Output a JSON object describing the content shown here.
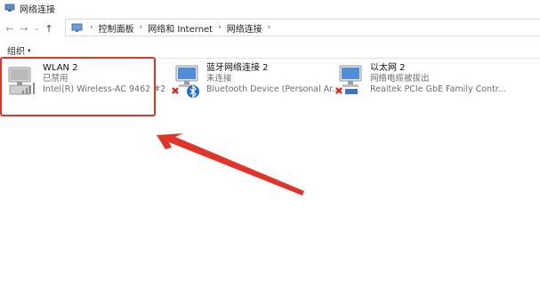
{
  "window": {
    "title": "网络连接"
  },
  "nav": {
    "back_glyph": "←",
    "forward_glyph": "→",
    "recent_glyph": "⌄",
    "up_glyph": "↑"
  },
  "address": {
    "separator": "›",
    "crumbs": [
      "控制面板",
      "网络和 Internet",
      "网络连接"
    ]
  },
  "commandbar": {
    "organize_label": "组织",
    "organize_caret": "▾"
  },
  "connections": [
    {
      "name": "WLAN 2",
      "status": "已禁用",
      "device": "Intel(R) Wireless-AC 9462 #2",
      "icon": "wifi-adapter-icon",
      "disabled": true
    },
    {
      "name": "蓝牙网络连接 2",
      "status": "未连接",
      "device": "Bluetooth Device (Personal Ar...",
      "icon": "bluetooth-adapter-icon",
      "disabled": true
    },
    {
      "name": "以太网 2",
      "status": "网络电缆被拔出",
      "device": "Realtek PCIe GbE Family Contr...",
      "icon": "ethernet-adapter-icon",
      "disabled": true
    }
  ],
  "annotation": {
    "highlight_color": "#e0342a",
    "arrow_color": "#e0342a"
  }
}
